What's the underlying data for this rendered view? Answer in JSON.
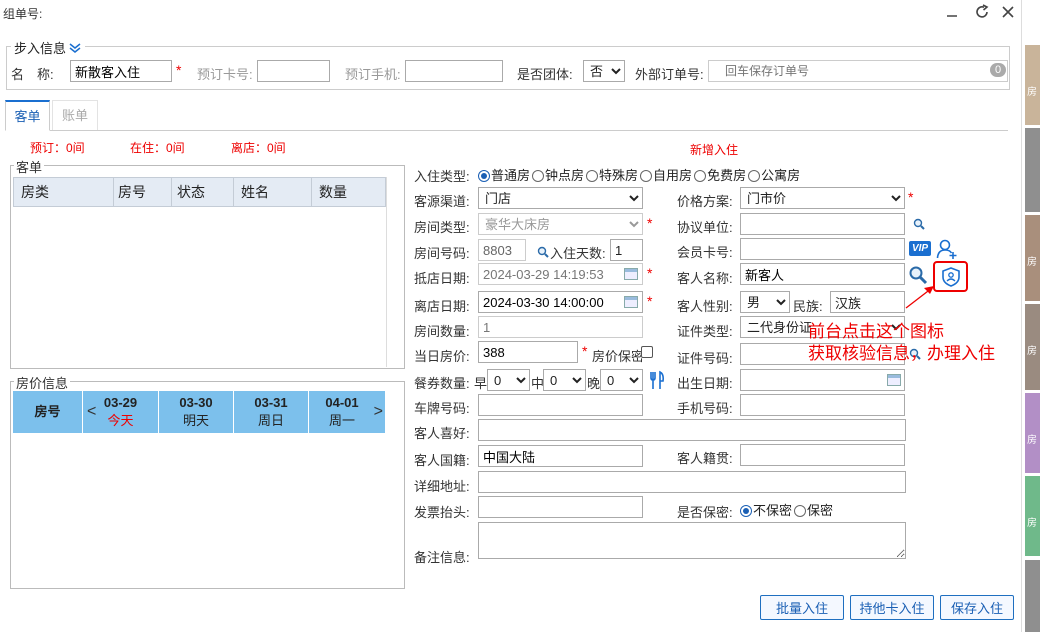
{
  "window": {
    "title": "组单号:"
  },
  "stepin": {
    "legend": "步入信息",
    "name_label": "名　称:",
    "name_value": "新散客入住",
    "booking_no_label": "预订卡号:",
    "booking_phone_label": "预订手机:",
    "group_label": "是否团体:",
    "group_value": "否",
    "external_label": "外部订单号:",
    "external_placeholder": "回车保存订单号",
    "external_count": "0"
  },
  "tabs": [
    {
      "label": "客单"
    },
    {
      "label": "账单"
    }
  ],
  "status": {
    "reserved": "预订：0间",
    "staying": "在住：0间",
    "leaving": "离店：0间",
    "new_checkin": "新增入住"
  },
  "order_panel": {
    "legend": "客单",
    "columns": [
      "房类",
      "房号",
      "状态",
      "姓名",
      "数量"
    ]
  },
  "price_panel": {
    "legend": "房价信息",
    "room_header": "房号",
    "days": [
      {
        "date": "03-29",
        "day": "今天"
      },
      {
        "date": "03-30",
        "day": "明天"
      },
      {
        "date": "03-31",
        "day": "周日"
      },
      {
        "date": "04-01",
        "day": "周一"
      }
    ]
  },
  "form": {
    "checkin_type_label": "入住类型:",
    "checkin_types": [
      "普通房",
      "钟点房",
      "特殊房",
      "自用房",
      "免费房",
      "公寓房"
    ],
    "source_label": "客源渠道:",
    "source_value": "门店",
    "price_plan_label": "价格方案:",
    "price_plan_value": "门市价",
    "room_type_label": "房间类型:",
    "room_type_value": "豪华大床房",
    "agreement_label": "协议单位:",
    "room_no_label": "房间号码:",
    "room_no_value": "8803",
    "days_label": "入住天数:",
    "days_value": "1",
    "member_label": "会员卡号:",
    "vip": "VIP",
    "arrive_label": "抵店日期:",
    "arrive_value": "2024-03-29 14:19:53",
    "guest_name_label": "客人名称:",
    "guest_name_value": "新客人",
    "leave_label": "离店日期:",
    "leave_value": "2024-03-30 14:00:00",
    "gender_label": "客人性别:",
    "gender_value": "男",
    "ethnic_label": "民族:",
    "ethnic_value": "汉族",
    "room_count_label": "房间数量:",
    "room_count_value": "1",
    "id_type_label": "证件类型:",
    "id_type_value": "二代身份证",
    "day_price_label": "当日房价:",
    "day_price_value": "388",
    "price_secret_label": "房价保密",
    "id_no_label": "证件号码:",
    "meal_label": "餐券数量:",
    "meal_breakfast": "早",
    "meal_lunch": "中",
    "meal_dinner": "晚",
    "meal_value": "0",
    "birthday_label": "出生日期:",
    "plate_label": "车牌号码:",
    "phone_label": "手机号码:",
    "hobby_label": "客人喜好:",
    "country_label": "客人国籍:",
    "country_value": "中国大陆",
    "native_label": "客人籍贯:",
    "address_label": "详细地址:",
    "invoice_label": "发票抬头:",
    "secret_label": "是否保密:",
    "secret_options": [
      "不保密",
      "保密"
    ],
    "remark_label": "备注信息:"
  },
  "annotation": {
    "line1": "前台点击这个图标",
    "line2": "获取核验信息，办理入住"
  },
  "buttons": {
    "batch": "批量入住",
    "other_card": "持他卡入住",
    "save": "保存入住"
  },
  "side_strip": {
    "label": "房"
  },
  "colors": {
    "accent": "#1a5fb4",
    "required": "#e00000",
    "grid_header": "#7cc0ec",
    "annotation": "#e00000"
  }
}
